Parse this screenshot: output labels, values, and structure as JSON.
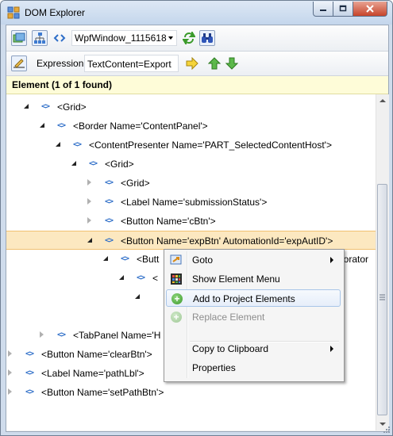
{
  "window": {
    "title": "DOM Explorer"
  },
  "toolbar": {
    "window_selector": "WpfWindow_1115618",
    "expression_label": "Expression:",
    "expression_value": "TextContent=Export"
  },
  "status": {
    "text": "Element (1 of 1 found)"
  },
  "tree": {
    "rows": [
      {
        "text": "<Grid>",
        "expander": "open"
      },
      {
        "text": "<Border Name='ContentPanel'>",
        "expander": "open"
      },
      {
        "text": "<ContentPresenter Name='PART_SelectedContentHost'>",
        "expander": "open"
      },
      {
        "text": "<Grid>",
        "expander": "open"
      },
      {
        "text": "<Grid>",
        "expander": "closed"
      },
      {
        "text": "<Label Name='submissionStatus'>",
        "expander": "closed"
      },
      {
        "text": "<Button Name='cBtn'>",
        "expander": "closed"
      },
      {
        "text": "<Button Name='expBtn' AutomationId='expAutID'>",
        "expander": "open",
        "selected": true
      },
      {
        "text": "<Butt",
        "tail": "ecorator",
        "expander": "open"
      },
      {
        "text": "<",
        "expander": "open"
      },
      {
        "text": "",
        "expander": "open"
      },
      {
        "text": "",
        "expander": "none"
      },
      {
        "text": "<TabPanel Name='H",
        "expander": "closed"
      },
      {
        "text": "<Button Name='clearBtn'>",
        "expander": "closed"
      },
      {
        "text": "<Label Name='pathLbl'>",
        "expander": "closed"
      },
      {
        "text": "<Button Name='setPathBtn'>",
        "expander": "closed"
      }
    ]
  },
  "context_menu": {
    "items": [
      {
        "label": "Goto",
        "icon": "goto-icon",
        "submenu": true
      },
      {
        "label": "Show Element Menu",
        "icon": "element-menu-icon"
      },
      {
        "label": "Add to Project Elements",
        "icon": "add-green-icon",
        "highlighted": true
      },
      {
        "label": "Replace Element",
        "icon": "add-gray-icon",
        "disabled": true
      },
      {
        "label": "Copy to Clipboard",
        "submenu": true
      },
      {
        "label": "Properties"
      }
    ]
  },
  "colors": {
    "selected_row": "#fce8c0",
    "node_icon": "#2f6fc8",
    "status_bar": "#fefcd8",
    "menu_highlight": "#e6eefa"
  }
}
